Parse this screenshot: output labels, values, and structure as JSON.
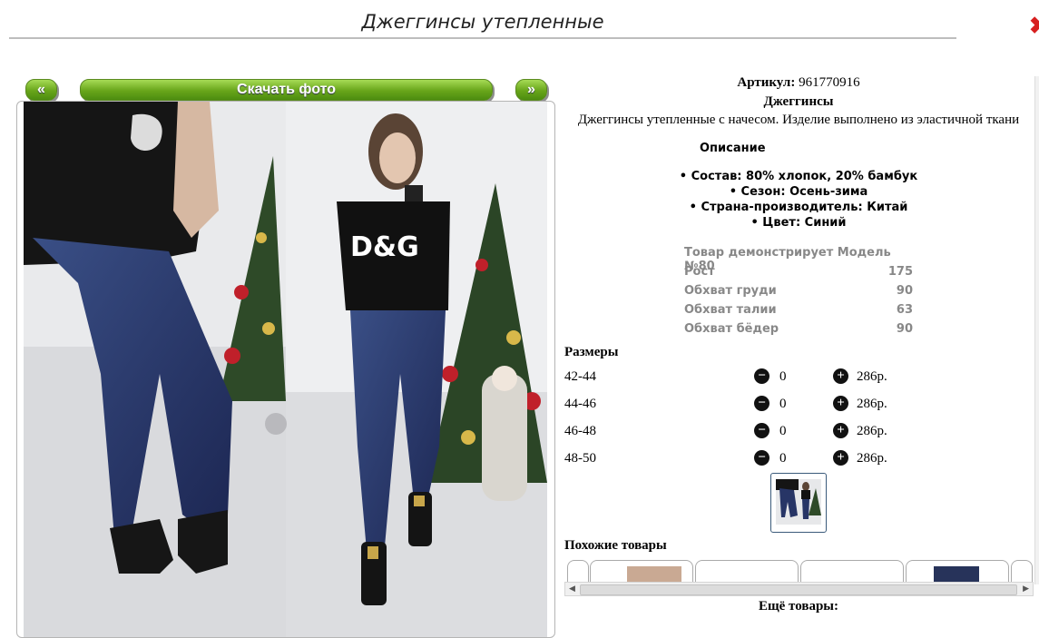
{
  "page": {
    "title": "Джеггинсы утепленные"
  },
  "nav": {
    "prev_label": "«",
    "download_label": "Скачать фото",
    "next_label": "»"
  },
  "product": {
    "article_label": "Артикул:",
    "article_value": "961770916",
    "category": "Джеггинсы",
    "description": "Джеггинсы утепленные с начесом. Изделие выполнено из эластичной ткани",
    "specs_title": "Описание",
    "specs": [
      "• Состав: 80% хлопок, 20% бамбук",
      "• Сезон: Осень-зима",
      "• Страна-производитель: Китай",
      "• Цвет: Синий"
    ]
  },
  "model": {
    "rows": [
      {
        "label": "Товар демонстрирует Модель №80",
        "value": ""
      },
      {
        "label": "Рост",
        "value": "175"
      },
      {
        "label": "Обхват груди",
        "value": "90"
      },
      {
        "label": "Обхват талии",
        "value": "63"
      },
      {
        "label": "Обхват бёдер",
        "value": "90"
      }
    ]
  },
  "sizes": {
    "title": "Размеры",
    "minus_icon": "minus-circle-icon",
    "plus_icon": "plus-circle-icon",
    "rows": [
      {
        "size": "42-44",
        "qty": "0",
        "price": "286р."
      },
      {
        "size": "44-46",
        "qty": "0",
        "price": "286р."
      },
      {
        "size": "46-48",
        "qty": "0",
        "price": "286р."
      },
      {
        "size": "48-50",
        "qty": "0",
        "price": "286р."
      }
    ]
  },
  "similar": {
    "title": "Похожие товары"
  },
  "more": {
    "title": "Ещё товары:"
  },
  "colors": {
    "accent_green": "#68a51a",
    "close_red": "#d71f1f",
    "muted_text": "#888888"
  }
}
